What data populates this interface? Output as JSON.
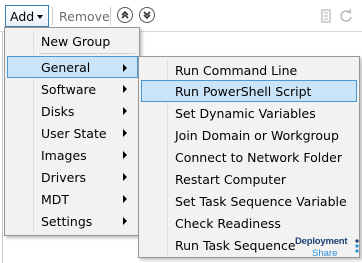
{
  "toolbar": {
    "add_label": "Add",
    "remove_label": "Remove"
  },
  "menu": {
    "items": [
      {
        "label": "New Group",
        "has_submenu": false
      },
      {
        "label": "General",
        "has_submenu": true,
        "highlighted": true
      },
      {
        "label": "Software",
        "has_submenu": true
      },
      {
        "label": "Disks",
        "has_submenu": true
      },
      {
        "label": "User State",
        "has_submenu": true
      },
      {
        "label": "Images",
        "has_submenu": true
      },
      {
        "label": "Drivers",
        "has_submenu": true
      },
      {
        "label": "MDT",
        "has_submenu": true
      },
      {
        "label": "Settings",
        "has_submenu": true
      }
    ]
  },
  "submenu": {
    "items": [
      {
        "label": "Run Command Line"
      },
      {
        "label": "Run PowerShell Script",
        "highlighted": true
      },
      {
        "label": "Set Dynamic Variables"
      },
      {
        "label": "Join Domain or Workgroup"
      },
      {
        "label": "Connect to Network Folder"
      },
      {
        "label": "Restart Computer"
      },
      {
        "label": "Set Task Sequence Variable"
      },
      {
        "label": "Check Readiness"
      },
      {
        "label": "Run Task Sequence"
      }
    ]
  },
  "logo": {
    "line1": "Deployment",
    "line2": "Share"
  },
  "colors": {
    "highlight_fill": "#cce4f7",
    "highlight_border": "#4a98d4",
    "menu_bg": "#f2f2f2",
    "logo_dark": "#1d3f73",
    "logo_light": "#2b8ed6"
  }
}
